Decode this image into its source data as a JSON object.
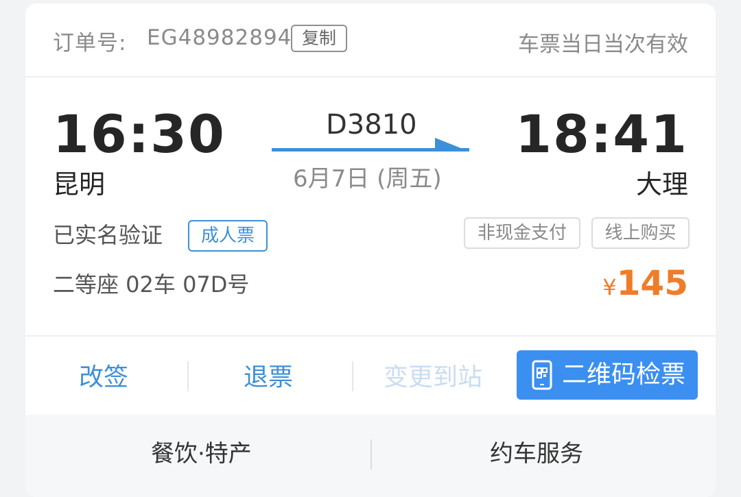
{
  "header": {
    "order_label": "订单号:",
    "order_number": "EG48982894",
    "copy_label": "复制",
    "validity": "车票当日当次有效"
  },
  "trip": {
    "departure_time": "16:30",
    "departure_station": "昆明",
    "arrival_time": "18:41",
    "arrival_station": "大理",
    "train_number": "D3810",
    "date": "6月7日 (周五)"
  },
  "passenger": {
    "verified": "已实名验证",
    "ticket_type": "成人票",
    "seat": "二等座 02车 07D号"
  },
  "tags": {
    "payment": "非现金支付",
    "purchase": "线上购买"
  },
  "price": {
    "currency": "¥",
    "amount": "145"
  },
  "actions": {
    "change": "改签",
    "refund": "退票",
    "change_station": "变更到站",
    "qr_check": "二维码检票"
  },
  "footer": {
    "food": "餐饮·特产",
    "car": "约车服务"
  },
  "colors": {
    "accent": "#3e8fd9",
    "button_bg": "#3b8ff0",
    "price": "#f07c2a",
    "disabled": "#c8ddf2"
  },
  "icons": {
    "qr": "phone-qr-icon",
    "arrow": "train-arrow-icon"
  }
}
